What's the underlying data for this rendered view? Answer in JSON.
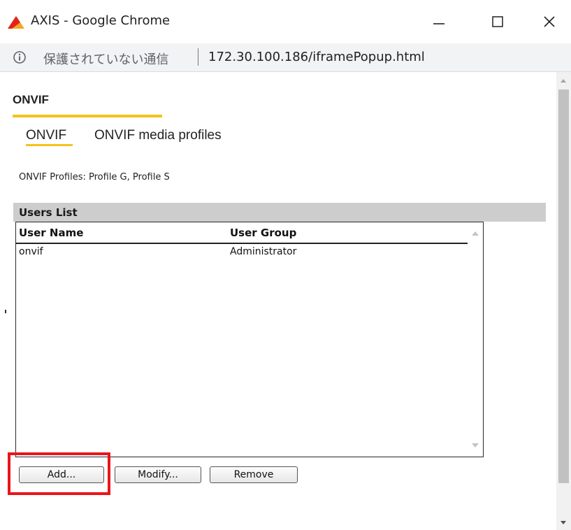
{
  "window": {
    "title": "AXIS - Google Chrome",
    "logo_icon": "axis-logo-icon",
    "controls": [
      "minimize-icon",
      "maximize-icon",
      "close-icon"
    ]
  },
  "addressbar": {
    "info_icon": "info-icon",
    "security_text": "保護されていない通信",
    "url": "172.30.100.186/iframePopup.html"
  },
  "page": {
    "section_title": "ONVIF",
    "tabs": [
      {
        "label": "ONVIF",
        "active": true
      },
      {
        "label": "ONVIF media profiles",
        "active": false
      }
    ],
    "profiles_text": "ONVIF Profiles: Profile G, Profile S",
    "users": {
      "title": "Users List",
      "columns": [
        "User Name",
        "User Group"
      ],
      "rows": [
        {
          "name": "onvif",
          "group": "Administrator"
        }
      ]
    },
    "buttons": {
      "add": "Add...",
      "modify": "Modify...",
      "remove": "Remove"
    }
  },
  "colors": {
    "accent": "#f4c31b",
    "highlight": "#e8161b",
    "header_bg": "#cdcdcd"
  }
}
